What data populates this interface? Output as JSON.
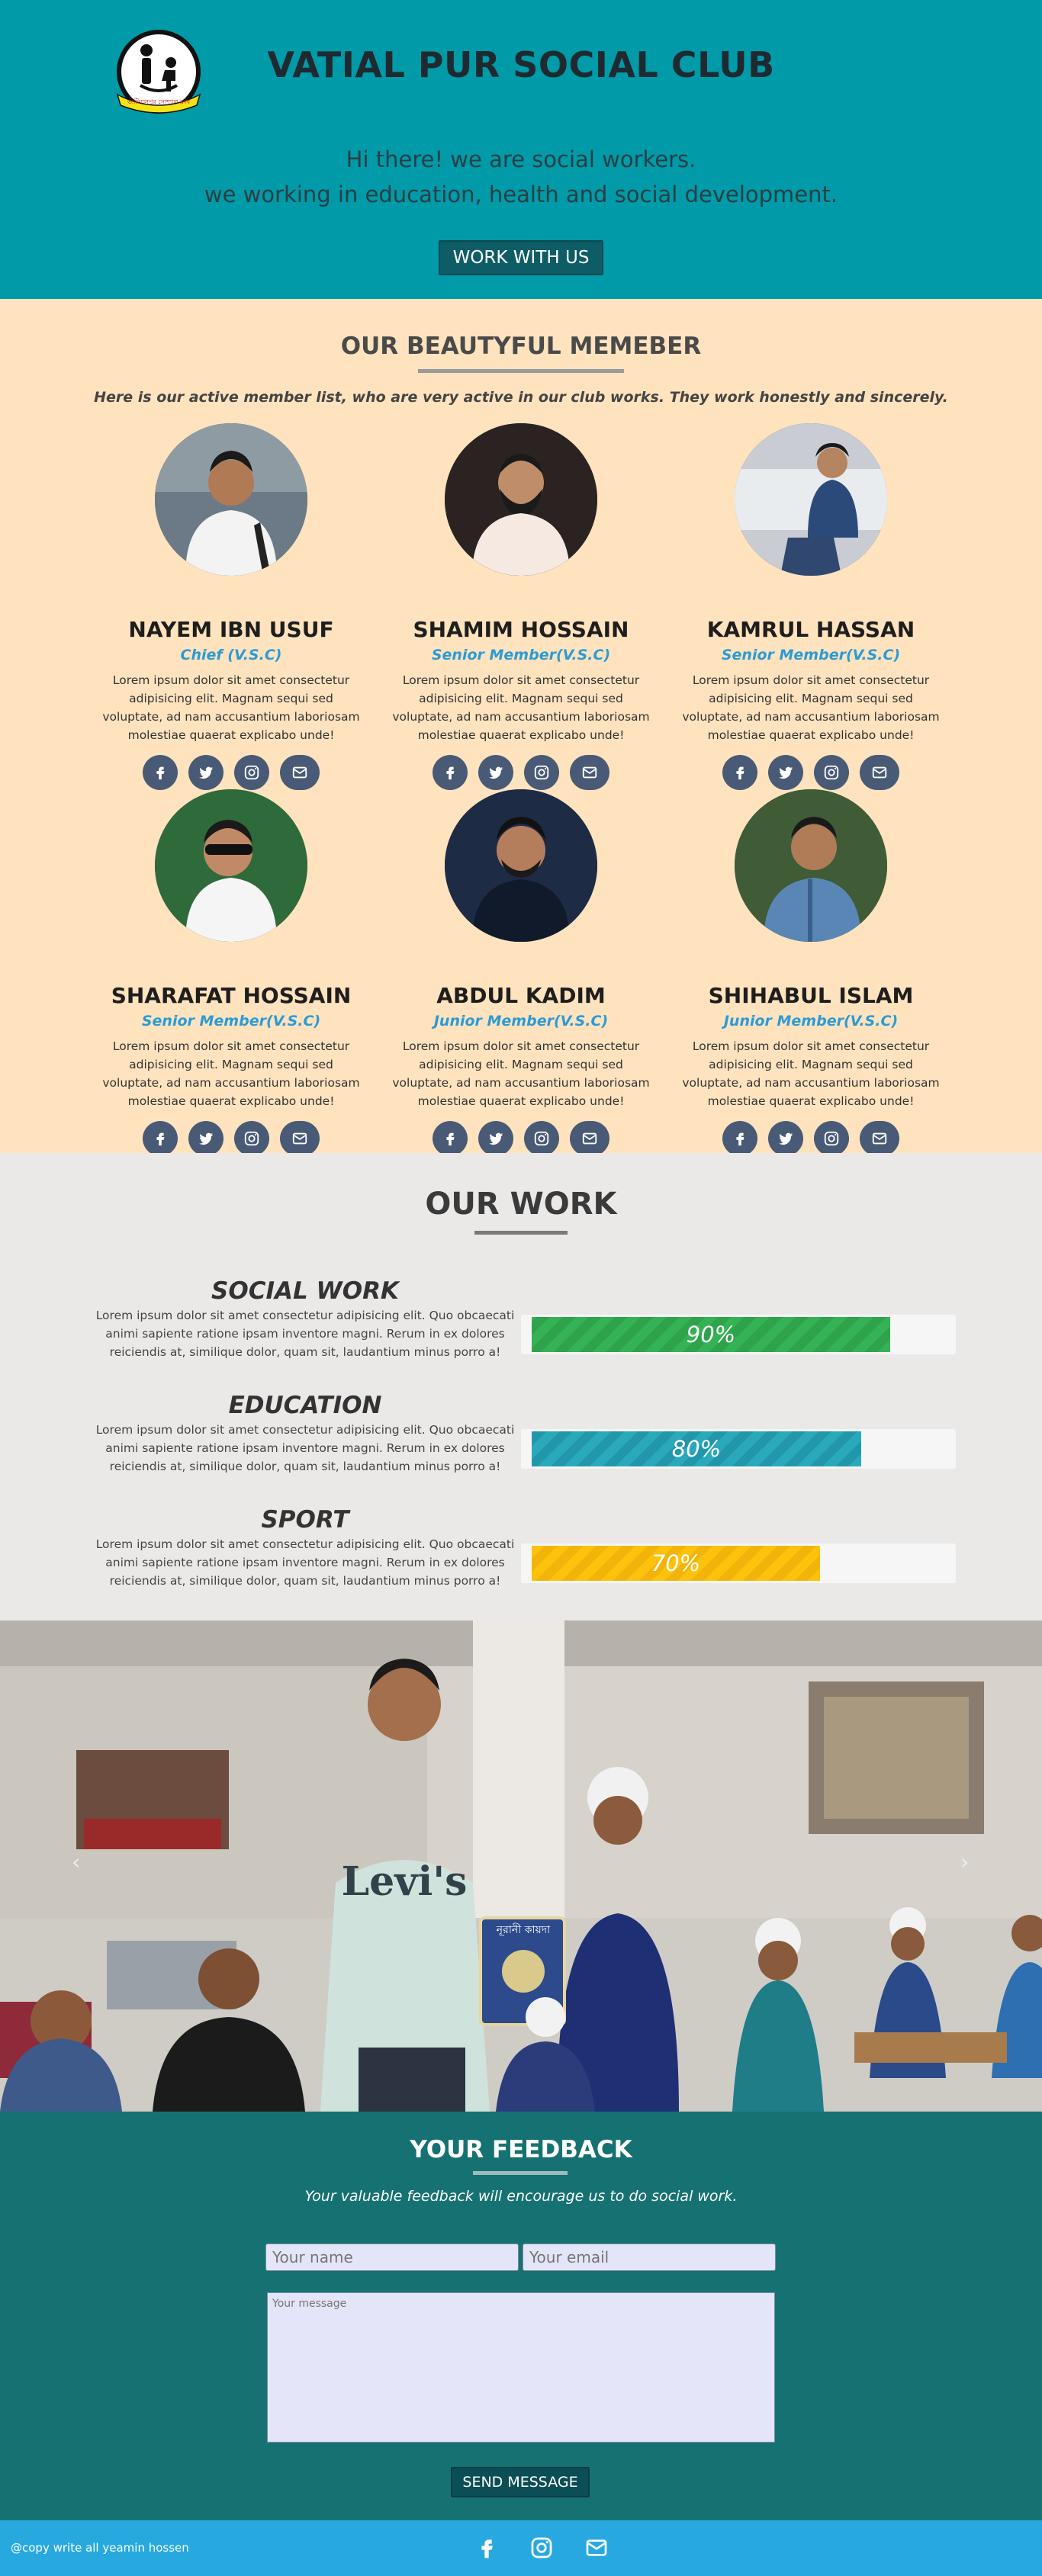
{
  "header": {
    "logo_text": "ভাটিয়ালপুর সোশ্যাল ক্লাব",
    "title": "VATIAL PUR SOCIAL CLUB",
    "intro_line1": "Hi there! we are social workers.",
    "intro_line2": "we working in education, health and social development.",
    "cta_label": "WORK WITH US"
  },
  "members": {
    "title": "OUR BEAUTYFUL MEMEBER",
    "subtitle": "Here is our active member list, who are very active in our club works. They work honestly and sincerely.",
    "items": [
      {
        "name": "NAYEM IBN USUF",
        "role": "Chief (V.S.C)",
        "desc": "Lorem ipsum dolor sit amet consectetur adipisicing elit. Magnam sequi sed voluptate, ad nam accusantium laboriosam molestiae quaerat explicabo unde!"
      },
      {
        "name": "SHAMIM HOSSAIN",
        "role": "Senior Member(V.S.C)",
        "desc": "Lorem ipsum dolor sit amet consectetur adipisicing elit. Magnam sequi sed voluptate, ad nam accusantium laboriosam molestiae quaerat explicabo unde!"
      },
      {
        "name": "KAMRUL HASSAN",
        "role": "Senior Member(V.S.C)",
        "desc": "Lorem ipsum dolor sit amet consectetur adipisicing elit. Magnam sequi sed voluptate, ad nam accusantium laboriosam molestiae quaerat explicabo unde!"
      },
      {
        "name": "SHARAFAT HOSSAIN",
        "role": "Senior Member(V.S.C)",
        "desc": "Lorem ipsum dolor sit amet consectetur adipisicing elit. Magnam sequi sed voluptate, ad nam accusantium laboriosam molestiae quaerat explicabo unde!"
      },
      {
        "name": "ABDUL KADIM",
        "role": "Junior Member(V.S.C)",
        "desc": "Lorem ipsum dolor sit amet consectetur adipisicing elit. Magnam sequi sed voluptate, ad nam accusantium laboriosam molestiae quaerat explicabo unde!"
      },
      {
        "name": "SHIHABUL ISLAM",
        "role": "Junior Member(V.S.C)",
        "desc": "Lorem ipsum dolor sit amet consectetur adipisicing elit. Magnam sequi sed voluptate, ad nam accusantium laboriosam molestiae quaerat explicabo unde!"
      }
    ],
    "social_icons": [
      "facebook-icon",
      "twitter-icon",
      "instagram-icon",
      "mail-icon"
    ]
  },
  "work": {
    "title": "OUR WORK",
    "items": [
      {
        "title": "SOCIAL WORK",
        "desc": "Lorem ipsum dolor sit amet consectetur adipisicing elit. Quo obcaecati animi sapiente ratione ipsam inventore magni. Rerum in ex dolores reiciendis at, similique dolor, quam sit, laudantium minus porro a!",
        "percent": "90%",
        "color": "#34b254"
      },
      {
        "title": "EDUCATION",
        "desc": "Lorem ipsum dolor sit amet consectetur adipisicing elit. Quo obcaecati animi sapiente ratione ipsam inventore magni. Rerum in ex dolores reiciendis at, similique dolor, quam sit, laudantium minus porro a!",
        "percent": "80%",
        "color": "#2aa9bd"
      },
      {
        "title": "SPORT",
        "desc": "Lorem ipsum dolor sit amet consectetur adipisicing elit. Quo obcaecati animi sapiente ratione ipsam inventore magni. Rerum in ex dolores reiciendis at, similique dolor, quam sit, laudantium minus porro a!",
        "percent": "70%",
        "color": "#fcc20c"
      }
    ]
  },
  "carousel": {
    "prev_icon": "chevron-left-icon",
    "next_icon": "chevron-right-icon",
    "shirt_text": "Levi's",
    "book_text": "নূরানী কায়দা"
  },
  "feedback": {
    "title": "YOUR FEEDBACK",
    "subtitle": "Your valuable feedback will encourage us to do social work.",
    "name_placeholder": "Your name",
    "email_placeholder": "Your email",
    "message_placeholder": "Your message",
    "send_label": "SEND MESSAGE"
  },
  "footer": {
    "copyright": "@copy write all yeamin hossen",
    "icons": [
      "facebook-icon",
      "instagram-icon",
      "mail-icon"
    ]
  },
  "colors": {
    "header_bg": "#009aa8",
    "members_bg": "#ffe3be",
    "work_bg": "#ebe9e8",
    "feedback_bg": "#167272",
    "footer_bg": "#27a9e0",
    "role_blue": "#2b9bd6"
  }
}
